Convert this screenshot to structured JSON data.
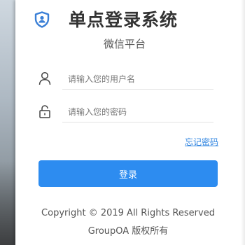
{
  "header": {
    "logo_icon": "shield-people-icon",
    "title": "单点登录系统",
    "subtitle": "微信平台"
  },
  "form": {
    "username": {
      "icon": "user-icon",
      "value": "",
      "placeholder": "请输入您的用户名"
    },
    "password": {
      "icon": "lock-icon",
      "value": "",
      "placeholder": "请输入您的密码"
    },
    "forgot_label": "忘记密码",
    "login_label": "登录"
  },
  "footer": {
    "copyright": "Copyright © 2019 All Rights Reserved",
    "company": "GroupOA 版权所有"
  },
  "colors": {
    "accent": "#2d8cf0",
    "link": "#2f84e0",
    "logo": "#3a7fd6",
    "text": "#333333"
  }
}
